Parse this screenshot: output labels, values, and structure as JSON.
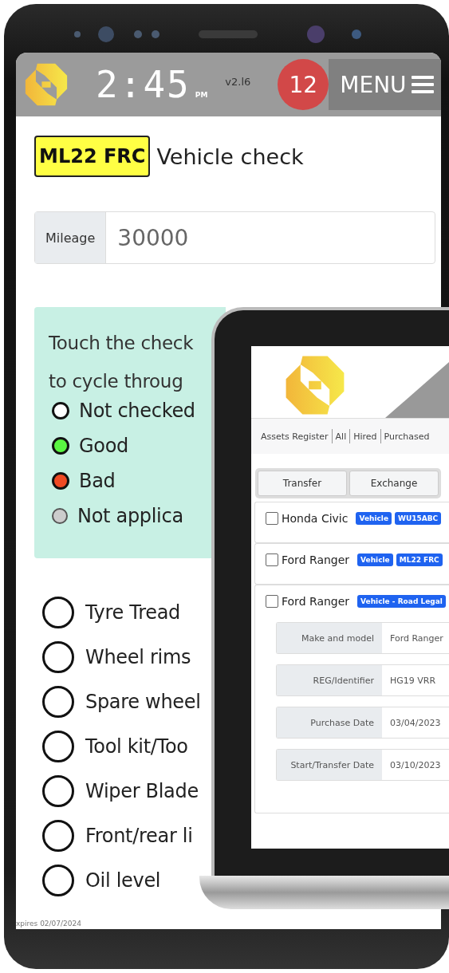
{
  "header": {
    "time": "2:45",
    "meridiem": "PM",
    "version": "v2.l6",
    "notifications": "12",
    "menu": "MENU"
  },
  "plate": "ML22 FRC",
  "title": "Vehicle check",
  "mileage": {
    "label": "Mileage",
    "value": "30000"
  },
  "info": {
    "lines": [
      "Touch the check",
      "to cycle throug"
    ],
    "legend": [
      {
        "label": "Not checked",
        "color": "#ffffff",
        "kind": "dot"
      },
      {
        "label": "Good",
        "color": "#5af542",
        "kind": "dot"
      },
      {
        "label": "Bad",
        "color": "#f04a24",
        "kind": "dot"
      },
      {
        "label": "Not applica",
        "color": "#cccccc",
        "kind": "na"
      }
    ]
  },
  "checks": [
    {
      "label": "Tyre Tread",
      "checked": false
    },
    {
      "label": "Wheel rims",
      "checked": false
    },
    {
      "label": "Spare wheel",
      "checked": false
    },
    {
      "label": "Tool kit/Too",
      "checked": false
    },
    {
      "label": "Wiper Blade",
      "checked": false
    },
    {
      "label": "Front/rear li",
      "checked": false
    },
    {
      "label": "Oil level",
      "checked": false
    }
  ],
  "footer": "xpires 02/07/2024",
  "laptop": {
    "nav": [
      "Assets Register",
      "All",
      "Hired",
      "Purchased"
    ],
    "actions": [
      "Transfer",
      "Exchange"
    ],
    "assets": [
      {
        "name": "Honda Civic",
        "checked": false,
        "tags": [
          {
            "text": "Vehicle",
            "color": "#1f63f0"
          },
          {
            "text": "WU15ABC",
            "color": "#1f63f0"
          }
        ]
      },
      {
        "name": "Ford Ranger",
        "checked": false,
        "tags": [
          {
            "text": "Vehicle",
            "color": "#1f63f0"
          },
          {
            "text": "ML22 FRC",
            "color": "#1f63f0"
          }
        ]
      },
      {
        "name": "Ford Ranger",
        "checked": false,
        "tags": [
          {
            "text": "Vehicle - Road Legal",
            "color": "#1f63f0"
          }
        ],
        "details": [
          {
            "label": "Make and model",
            "value": "Ford Ranger"
          },
          {
            "label": "REG/Identifier",
            "value": "HG19 VRR"
          },
          {
            "label": "Purchase Date",
            "value": "03/04/2023"
          },
          {
            "label": "Start/Transfer Date",
            "value": "03/10/2023"
          }
        ]
      }
    ]
  }
}
